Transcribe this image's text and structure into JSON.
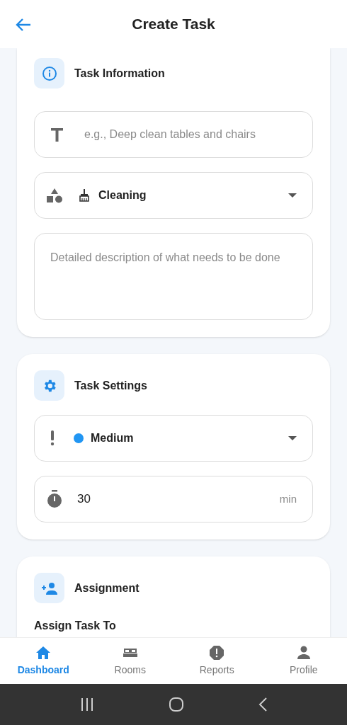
{
  "header": {
    "title": "Create Task"
  },
  "task_information": {
    "title": "Task Information",
    "title_field": {
      "placeholder": "e.g., Deep clean tables and chairs"
    },
    "category": {
      "value": "Cleaning"
    },
    "description": {
      "placeholder": "Detailed description of what needs to be done"
    }
  },
  "task_settings": {
    "title": "Task Settings",
    "priority": {
      "value": "Medium",
      "color": "#2196f3"
    },
    "duration": {
      "value": "30",
      "unit": "min"
    }
  },
  "assignment": {
    "title": "Assignment",
    "subtitle": "Assign Task To"
  },
  "bottom_nav": [
    {
      "label": "Dashboard",
      "kind": "home",
      "selected": true
    },
    {
      "label": "Rooms",
      "kind": "bed",
      "selected": false
    },
    {
      "label": "Reports",
      "kind": "report",
      "selected": false
    },
    {
      "label": "Profile",
      "kind": "person",
      "selected": false
    }
  ]
}
